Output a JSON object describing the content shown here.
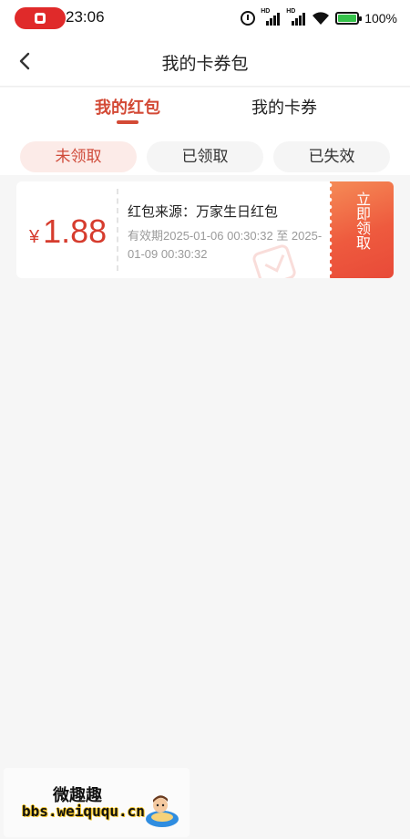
{
  "status_bar": {
    "time": "23:06",
    "battery": "100%",
    "icons": [
      "record-icon",
      "alarm-icon",
      "signal-hd-icon",
      "signal-hd-icon",
      "wifi-icon",
      "battery-icon"
    ]
  },
  "header": {
    "title": "我的卡券包",
    "back_icon": "chevron-left-icon"
  },
  "tabs": [
    {
      "label": "我的红包",
      "active": true
    },
    {
      "label": "我的卡券",
      "active": false
    }
  ],
  "filters": [
    {
      "label": "未领取",
      "selected": true
    },
    {
      "label": "已领取",
      "selected": false
    },
    {
      "label": "已失效",
      "selected": false
    }
  ],
  "coupons": [
    {
      "currency": "¥",
      "amount": "1.88",
      "source": "红包来源：万家生日红包",
      "validity": "有效期2025-01-06 00:30:32 至 2025-01-09 00:30:32",
      "action": "立即领取"
    }
  ],
  "watermark": {
    "title": "微趣趣",
    "url": "bbs.weiququ.cn"
  },
  "colors": {
    "accent": "#d34a36",
    "amount": "#d63c2e",
    "pill_selected_bg": "#fcebe8",
    "claim_gradient_start": "#f58b56",
    "claim_gradient_end": "#e84a38",
    "page_bg": "#f6f6f6"
  }
}
